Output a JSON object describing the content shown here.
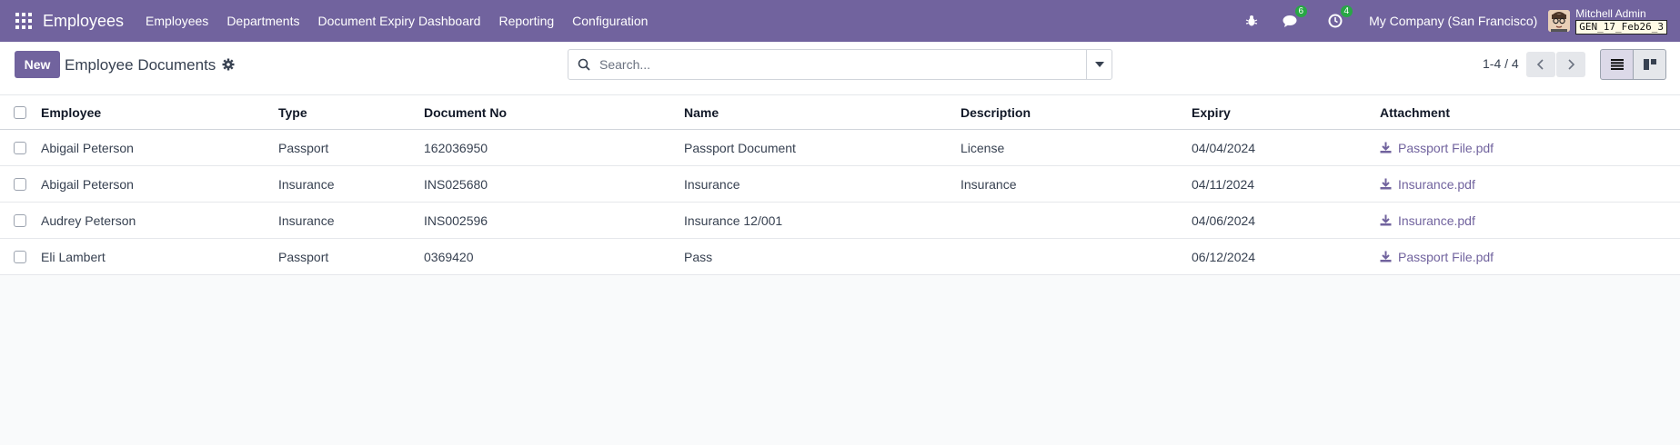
{
  "navbar": {
    "brand": "Employees",
    "menu": [
      "Employees",
      "Departments",
      "Document Expiry Dashboard",
      "Reporting",
      "Configuration"
    ],
    "messages_count": "6",
    "activities_count": "4",
    "company": "My Company (San Francisco)",
    "user_name": "Mitchell Admin",
    "db_name": "GEN_17_Feb26_3"
  },
  "control_panel": {
    "new_label": "New",
    "title": "Employee Documents",
    "search_placeholder": "Search...",
    "pager": "1-4 / 4"
  },
  "table": {
    "columns": [
      "Employee",
      "Type",
      "Document No",
      "Name",
      "Description",
      "Expiry",
      "Attachment"
    ],
    "rows": [
      {
        "employee": "Abigail Peterson",
        "type": "Passport",
        "doc_no": "162036950",
        "name": "Passport Document",
        "description": "License",
        "expiry": "04/04/2024",
        "attachment": "Passport File.pdf"
      },
      {
        "employee": "Abigail Peterson",
        "type": "Insurance",
        "doc_no": "INS025680",
        "name": "Insurance",
        "description": "Insurance",
        "expiry": "04/11/2024",
        "attachment": "Insurance.pdf"
      },
      {
        "employee": "Audrey Peterson",
        "type": "Insurance",
        "doc_no": "INS002596",
        "name": "Insurance 12/001",
        "description": "",
        "expiry": "04/06/2024",
        "attachment": "Insurance.pdf"
      },
      {
        "employee": "Eli Lambert",
        "type": "Passport",
        "doc_no": "0369420",
        "name": "Pass",
        "description": "",
        "expiry": "06/12/2024",
        "attachment": "Passport File.pdf"
      }
    ]
  },
  "colors": {
    "brand": "#71639e",
    "badge": "#28a745"
  }
}
